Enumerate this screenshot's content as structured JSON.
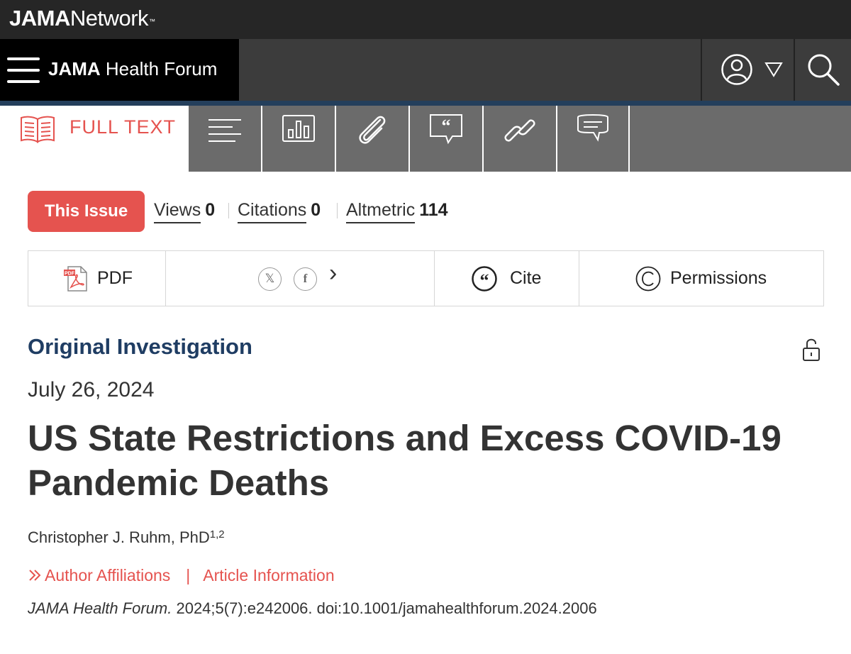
{
  "network": {
    "brand_bold": "JAMA",
    "brand_light": "Network",
    "trademark": "™"
  },
  "journal": {
    "brand_bold": "JAMA",
    "brand_light": "Health Forum"
  },
  "tabs": {
    "full_text": "FULL TEXT",
    "icons": [
      "outline-icon",
      "figures-icon",
      "supplemental-icon",
      "references-icon",
      "related-links-icon",
      "comments-icon"
    ]
  },
  "metrics": {
    "this_issue": "This Issue",
    "views_label": "Views",
    "views_value": "0",
    "citations_label": "Citations",
    "citations_value": "0",
    "altmetric_label": "Altmetric",
    "altmetric_value": "114"
  },
  "toolbar": {
    "pdf": "PDF",
    "share_x": "𝕏",
    "share_facebook": "f",
    "more_share": "›",
    "cite": "Cite",
    "permissions": "Permissions"
  },
  "article": {
    "type": "Original Investigation",
    "date": "July 26, 2024",
    "title": "US State Restrictions and Excess COVID-19 Pandemic Deaths",
    "author": "Christopher J. Ruhm, PhD",
    "author_sup": "1,2",
    "affiliations_link": "Author Affiliations",
    "link_separator": "|",
    "article_info_link": "Article Information",
    "journal_name": "JAMA Health Forum.",
    "citation_rest": " 2024;5(7):e242006. doi:10.1001/jamahealthforum.2024.2006"
  },
  "colors": {
    "accent": "#e5534f",
    "navy": "#1f3d63",
    "header_dark": "#262626",
    "tab_gray": "#6b6b6b"
  }
}
